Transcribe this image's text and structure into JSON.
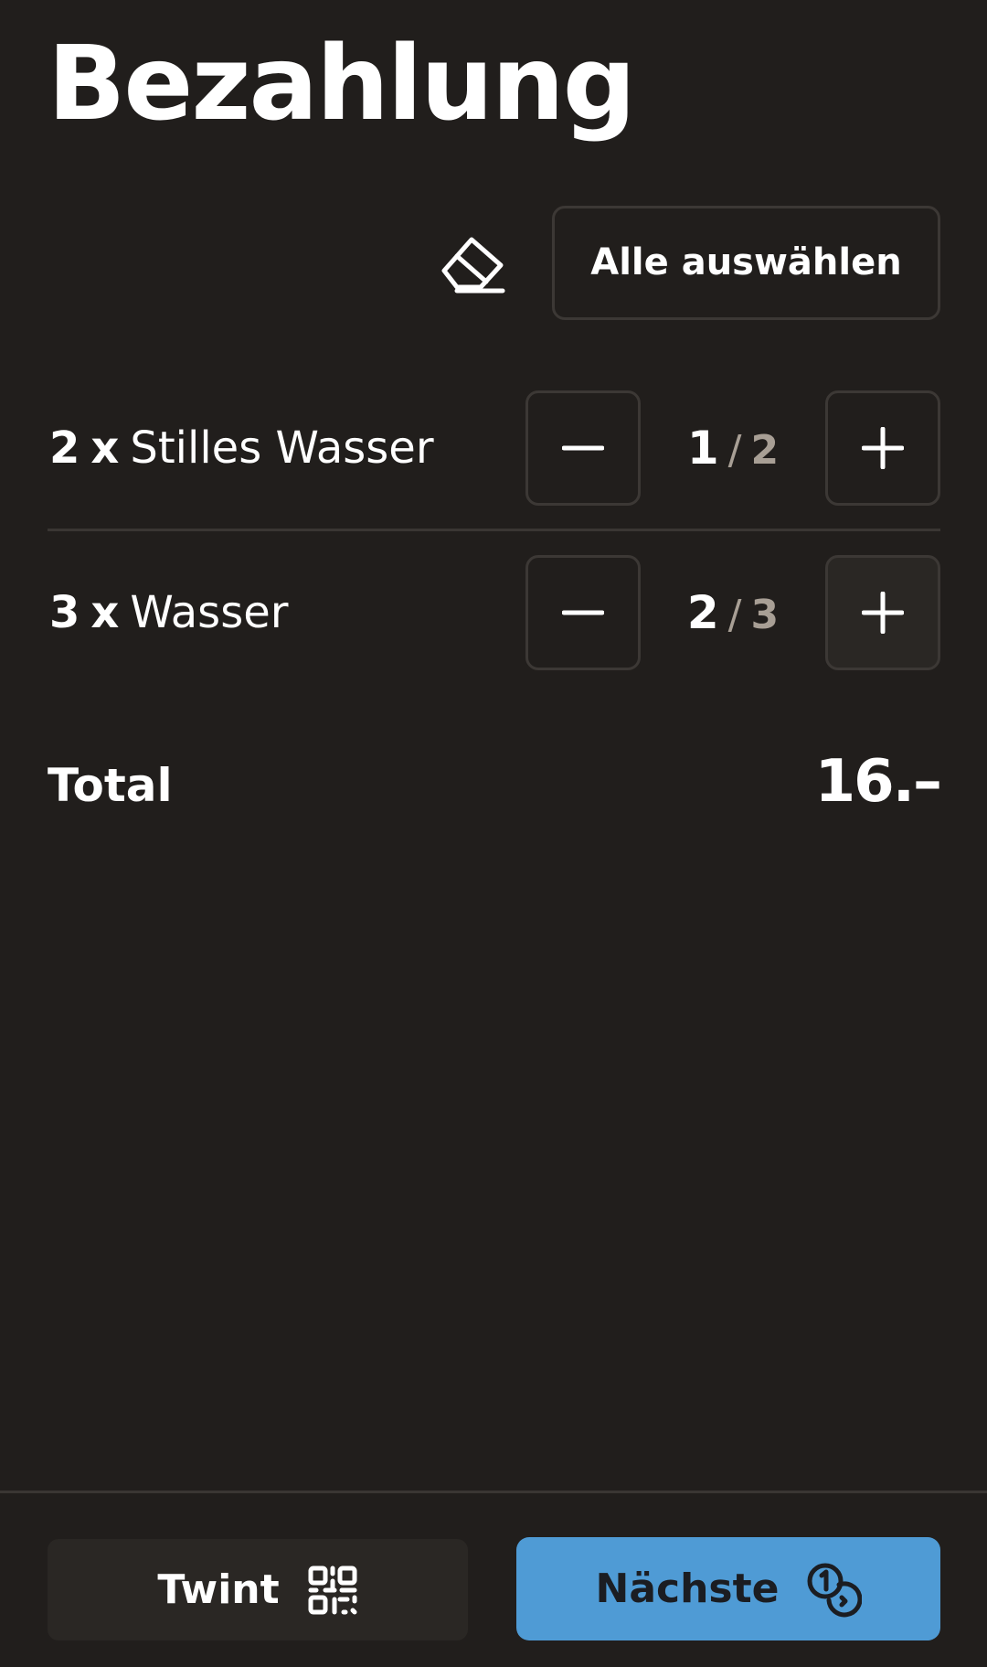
{
  "header": {
    "title": "Bezahlung"
  },
  "toolbar": {
    "eraser_icon": "eraser-icon",
    "select_all_label": "Alle auswählen"
  },
  "items": [
    {
      "quantity": "2",
      "times": "x",
      "name": "Stilles Wasser",
      "selected": "1",
      "separator": "/",
      "total": "2"
    },
    {
      "quantity": "3",
      "times": "x",
      "name": "Wasser",
      "selected": "2",
      "separator": "/",
      "total": "3"
    }
  ],
  "summary": {
    "total_label": "Total",
    "total_value": "16.–"
  },
  "footer": {
    "twint_label": "Twint",
    "twint_icon": "qr-code-icon",
    "next_label": "Nächste",
    "next_icon": "coins-icon"
  },
  "colors": {
    "background": "#211e1c",
    "accent": "#4f9bd5",
    "border": "#3c3835",
    "muted_text": "#a89f95"
  }
}
